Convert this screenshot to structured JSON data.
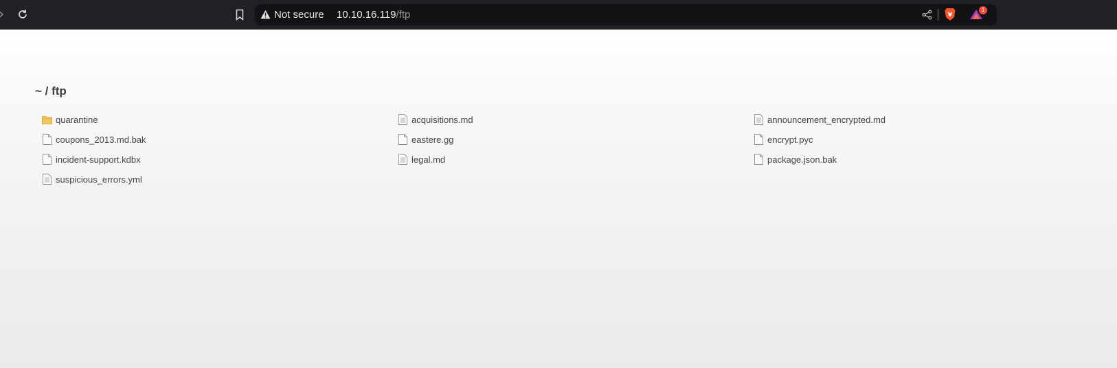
{
  "browser": {
    "security_label": "Not secure",
    "url_host": "10.10.16.119",
    "url_path": "/ftp",
    "rewards_badge": "1"
  },
  "directory": {
    "breadcrumb": "~ / ftp",
    "items": [
      {
        "name": "quarantine",
        "icon": "folder-icon"
      },
      {
        "name": "acquisitions.md",
        "icon": "text-file-icon"
      },
      {
        "name": "announcement_encrypted.md",
        "icon": "text-file-icon"
      },
      {
        "name": "coupons_2013.md.bak",
        "icon": "file-icon"
      },
      {
        "name": "eastere.gg",
        "icon": "file-icon"
      },
      {
        "name": "encrypt.pyc",
        "icon": "file-icon"
      },
      {
        "name": "incident-support.kdbx",
        "icon": "file-icon"
      },
      {
        "name": "legal.md",
        "icon": "text-file-icon"
      },
      {
        "name": "package.json.bak",
        "icon": "file-icon"
      },
      {
        "name": "suspicious_errors.yml",
        "icon": "text-file-icon"
      }
    ]
  },
  "colors": {
    "toolbar_bg": "#202124",
    "omnibox_bg": "#131316",
    "folder": "#f2c75c",
    "brave_orange": "#fb542b"
  }
}
